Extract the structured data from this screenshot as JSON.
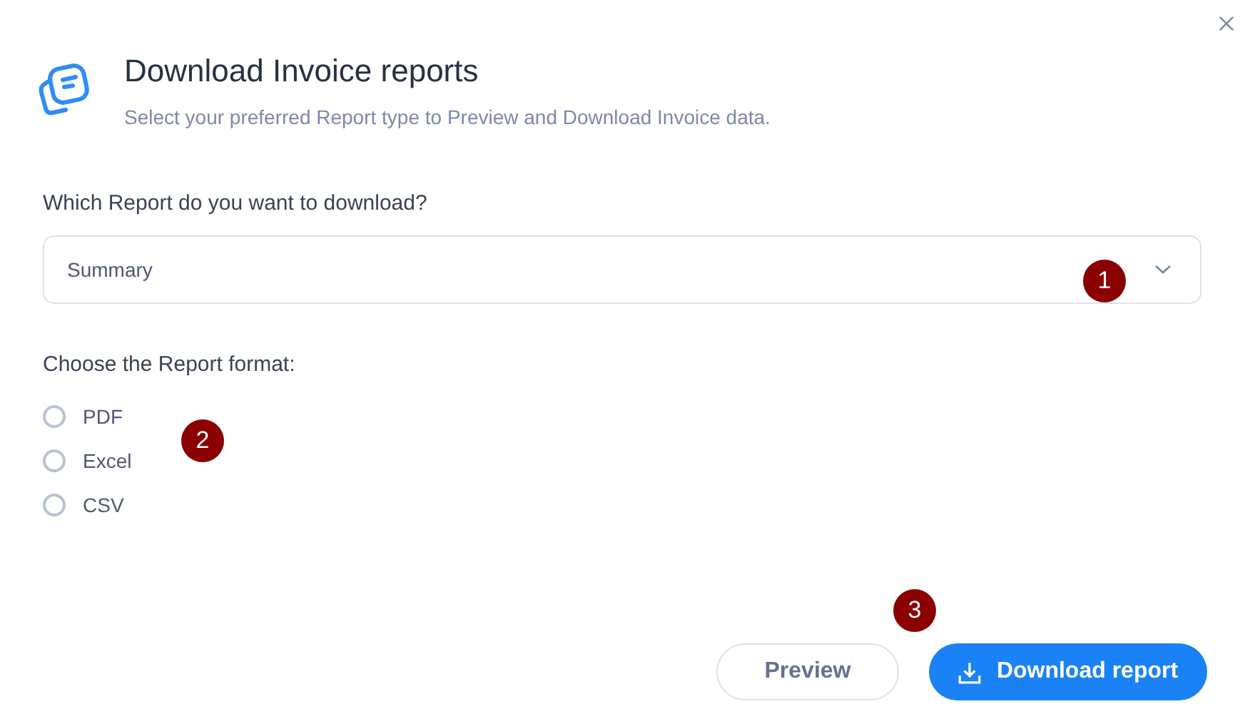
{
  "dialog": {
    "title": "Download Invoice reports",
    "subtitle": "Select your preferred Report type to Preview and Download Invoice data."
  },
  "report_select": {
    "label": "Which Report do you want to download?",
    "value": "Summary"
  },
  "format": {
    "label": "Choose the Report format:",
    "options": [
      {
        "label": "PDF",
        "selected": false
      },
      {
        "label": "Excel",
        "selected": false
      },
      {
        "label": "CSV",
        "selected": false
      }
    ]
  },
  "buttons": [
    {
      "label": "Preview",
      "kind": "secondary"
    },
    {
      "label": "Download report",
      "kind": "primary"
    }
  ],
  "callouts": [
    "1",
    "2",
    "3"
  ]
}
